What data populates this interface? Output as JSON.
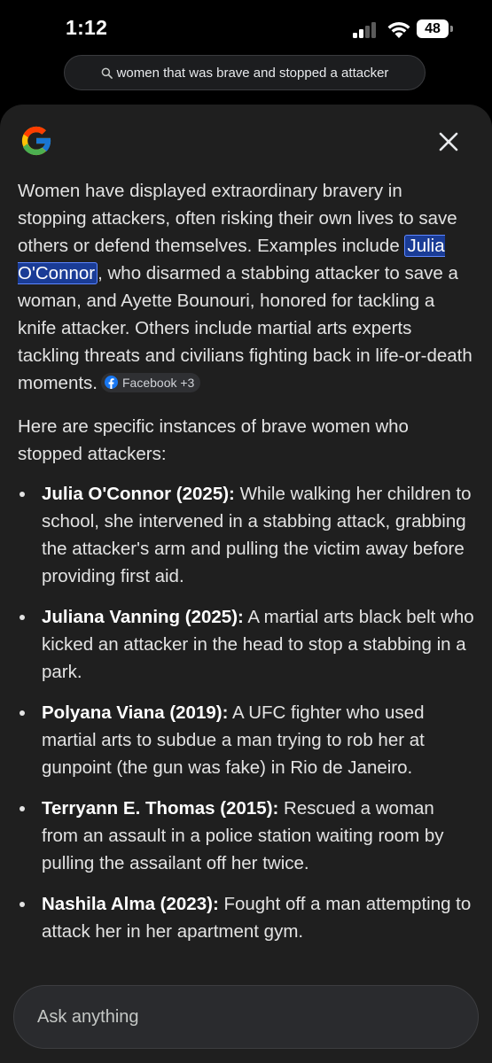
{
  "status_bar": {
    "time": "1:12",
    "battery": "48"
  },
  "search": {
    "query": "women that was brave and stopped a attacker"
  },
  "overview": {
    "intro_before": "Women have displayed extraordinary bravery in stopping attackers, often risking their own lives to save others or defend themselves. Examples include ",
    "intro_highlight": "Julia O'Connor",
    "intro_after": ", who disarmed a stabbing attacker to save a woman, and Ayette Bounouri, honored for tackling a knife attacker. Others include martial arts experts tackling threats and civilians fighting back in life-or-death moments.",
    "source_chip": "Facebook +3",
    "subhead": "Here are specific instances of brave women who stopped attackers:",
    "instances": [
      {
        "name": "Julia O'Connor (2025):",
        "text": " While walking her children to school, she intervened in a stabbing attack, grabbing the attacker's arm and pulling the victim away before providing first aid."
      },
      {
        "name": "Juliana Vanning (2025):",
        "text": " A martial arts black belt who kicked an attacker in the head to stop a stabbing in a park."
      },
      {
        "name": "Polyana Viana (2019):",
        "text": " A UFC fighter who used martial arts to subdue a man trying to rob her at gunpoint (the gun was fake) in Rio de Janeiro."
      },
      {
        "name": "Terryann E. Thomas (2015):",
        "text": " Rescued a woman from an assault in a police station waiting room by pulling the assailant off her twice."
      },
      {
        "name": "Nashila Alma (2023):",
        "text": " Fought off a man attempting to attack her in her apartment gym."
      }
    ]
  },
  "ask_bar": {
    "placeholder": "Ask anything"
  },
  "icons": {
    "logo": "google-g-logo",
    "close": "close-icon",
    "search": "search-icon",
    "source": "facebook-icon"
  },
  "colors": {
    "background": "#000000",
    "sheet": "#1f1f1f",
    "highlight": "#1a3c96",
    "highlight_border": "#5c86ff",
    "facebook_blue": "#1877f2"
  }
}
